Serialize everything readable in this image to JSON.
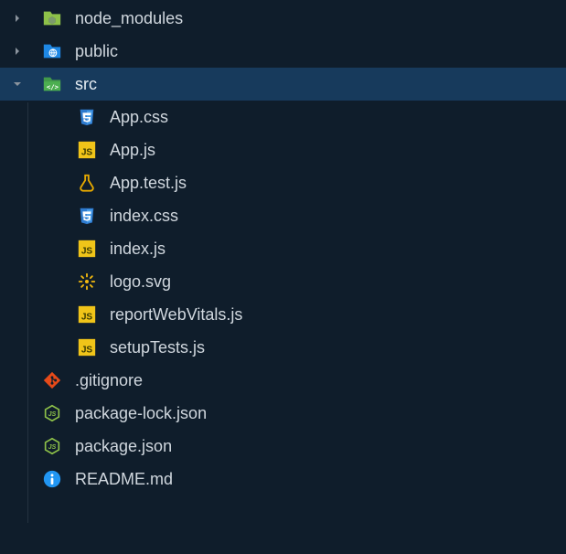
{
  "tree": {
    "items": [
      {
        "name": "node_modules",
        "icon": "folder-node",
        "depth": 0,
        "expanded": false,
        "type": "folder"
      },
      {
        "name": "public",
        "icon": "folder-public",
        "depth": 0,
        "expanded": false,
        "type": "folder"
      },
      {
        "name": "src",
        "icon": "folder-src",
        "depth": 0,
        "expanded": true,
        "type": "folder",
        "selected": true
      },
      {
        "name": "App.css",
        "icon": "css",
        "depth": 1,
        "type": "file"
      },
      {
        "name": "App.js",
        "icon": "js",
        "depth": 1,
        "type": "file"
      },
      {
        "name": "App.test.js",
        "icon": "test",
        "depth": 1,
        "type": "file"
      },
      {
        "name": "index.css",
        "icon": "css",
        "depth": 1,
        "type": "file"
      },
      {
        "name": "index.js",
        "icon": "js",
        "depth": 1,
        "type": "file"
      },
      {
        "name": "logo.svg",
        "icon": "svg",
        "depth": 1,
        "type": "file"
      },
      {
        "name": "reportWebVitals.js",
        "icon": "js",
        "depth": 1,
        "type": "file"
      },
      {
        "name": "setupTests.js",
        "icon": "js",
        "depth": 1,
        "type": "file"
      },
      {
        "name": ".gitignore",
        "icon": "git",
        "depth": 0,
        "type": "file"
      },
      {
        "name": "package-lock.json",
        "icon": "nodejs",
        "depth": 0,
        "type": "file"
      },
      {
        "name": "package.json",
        "icon": "nodejs",
        "depth": 0,
        "type": "file"
      },
      {
        "name": "README.md",
        "icon": "info",
        "depth": 0,
        "type": "file"
      }
    ]
  },
  "colors": {
    "folder_node": "#8dc149",
    "folder_public": "#1e88e5",
    "folder_src": "#4caf50",
    "css": "#2e7bcf",
    "js_bg": "#f0c419",
    "js_text": "#3a3a00",
    "test": "#e6a900",
    "svg": "#f2b90f",
    "git": "#e64a19",
    "nodejs": "#8dc149",
    "info": "#2196f3"
  }
}
